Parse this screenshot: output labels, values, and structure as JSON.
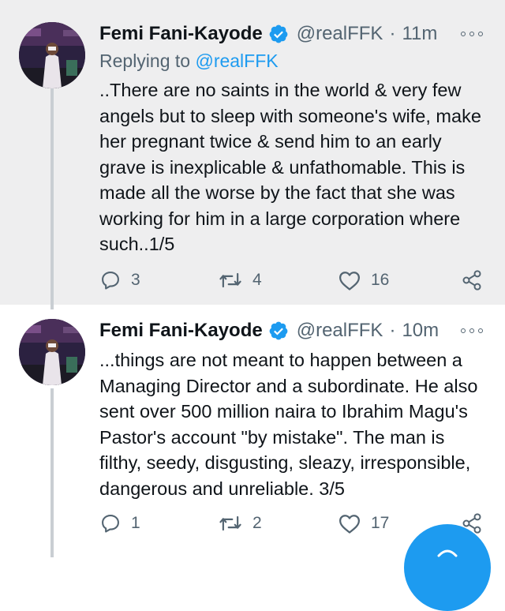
{
  "tweets": [
    {
      "author": "Femi Fani-Kayode",
      "handle": "@realFFK",
      "separator": "·",
      "time": "11m",
      "replying_label": "Replying to",
      "replying_handle": "@realFFK",
      "text": "..There are no saints in the world & very few angels but to sleep with someone's wife, make her pregnant twice & send him to an early grave is inexplicable & unfathomable. This is made all the worse by the fact that she was working for him in a large corporation where such..1/5",
      "replies": "3",
      "retweets": "4",
      "likes": "16"
    },
    {
      "author": "Femi Fani-Kayode",
      "handle": "@realFFK",
      "separator": "·",
      "time": "10m",
      "text": "...things are not meant to happen between a Managing Director and a subordinate. He also sent over 500 million naira to Ibrahim Magu's Pastor's account \"by mistake\". The man is filthy, seedy, disgusting, sleazy, irresponsible, dangerous and unreliable. 3/5",
      "replies": "1",
      "retweets": "2",
      "likes": "17"
    }
  ],
  "icons": {
    "verified": "verified-badge-icon",
    "more": "more-options-icon",
    "reply": "reply-icon",
    "retweet": "retweet-icon",
    "like": "heart-icon",
    "share": "share-icon",
    "compose": "compose-icon"
  },
  "colors": {
    "accent": "#1d9bf0",
    "secondary_text": "#536471",
    "highlight_background": "#eeeeef"
  }
}
